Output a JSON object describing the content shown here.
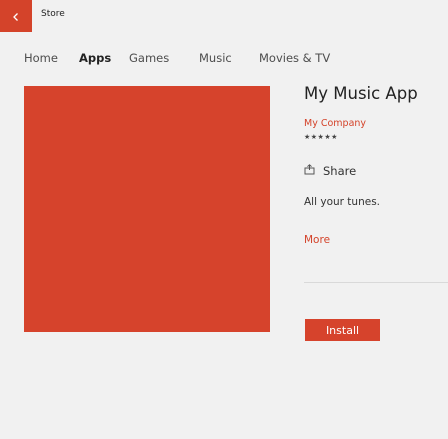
{
  "window": {
    "title": "Store",
    "back_icon": "arrow-left-icon"
  },
  "nav": {
    "items": [
      "Home",
      "Apps",
      "Games",
      "Music",
      "Movies & TV"
    ],
    "active": "Apps"
  },
  "app": {
    "name": "My Music App",
    "publisher": "My Company",
    "rating_text": "★★★★★",
    "share_label": "Share",
    "description": "All your tunes.",
    "more_label": "More",
    "install_label": "Install"
  },
  "colors": {
    "accent": "#d6432c",
    "background": "#f1f1f1"
  }
}
